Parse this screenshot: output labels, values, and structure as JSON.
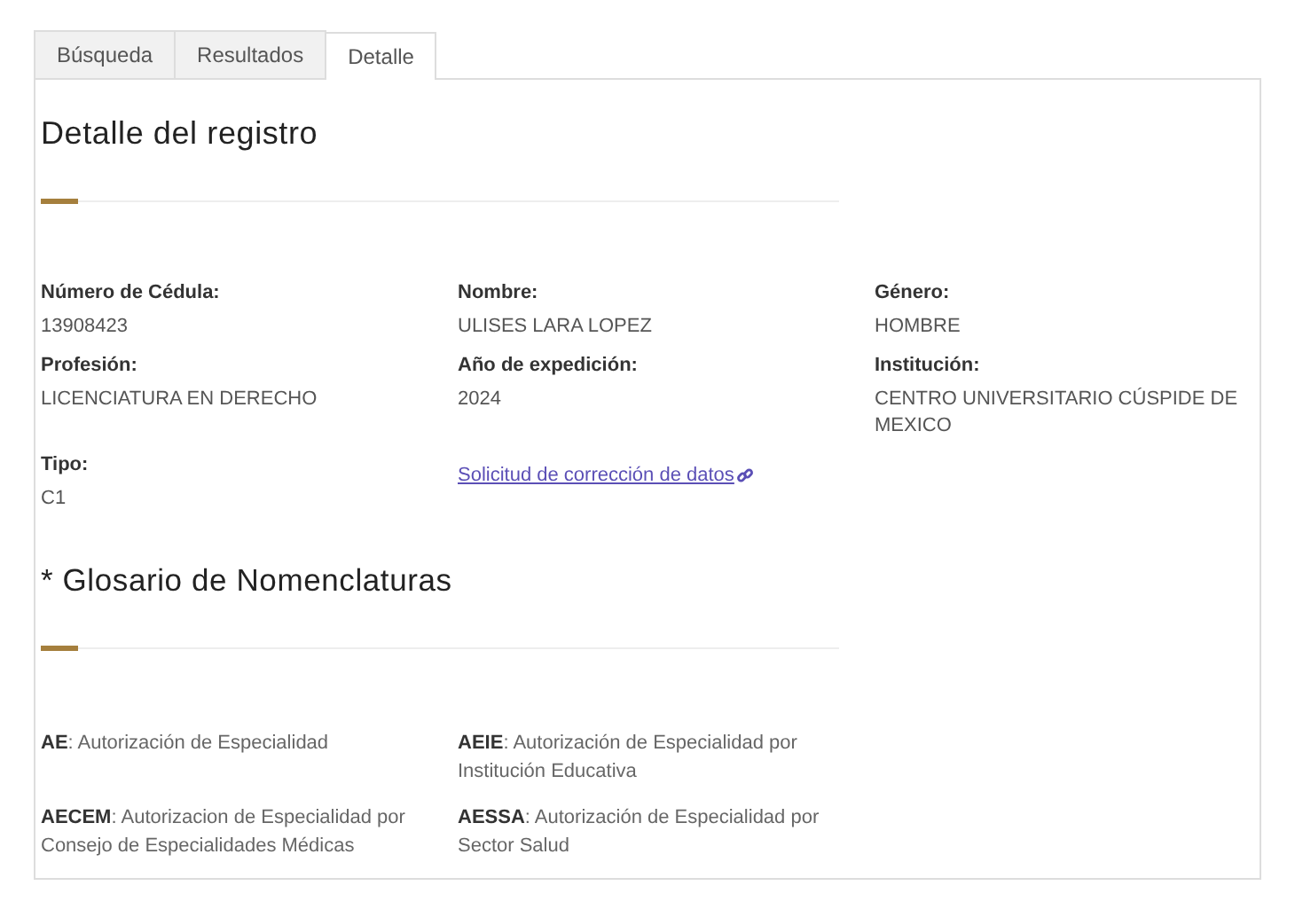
{
  "tabs": [
    {
      "label": "Búsqueda",
      "selected": false
    },
    {
      "label": "Resultados",
      "selected": false
    },
    {
      "label": "Detalle",
      "selected": true
    }
  ],
  "detail": {
    "title": "Detalle del registro",
    "fields": [
      {
        "label": "Número de Cédula:",
        "value": "13908423"
      },
      {
        "label": "Nombre:",
        "value": "ULISES LARA LOPEZ"
      },
      {
        "label": "Género:",
        "value": "HOMBRE"
      },
      {
        "label": "Profesión:",
        "value": "LICENCIATURA EN DERECHO"
      },
      {
        "label": "Año de expedición:",
        "value": "2024"
      },
      {
        "label": "Institución:",
        "value": "CENTRO UNIVERSITARIO CÚSPIDE DE MEXICO"
      },
      {
        "label": "Tipo:",
        "value": "C1"
      }
    ],
    "link": "Solicitud de corrección de datos"
  },
  "glossary": {
    "title": "* Glosario de Nomenclaturas",
    "entries": [
      "**AE**: Autorización de Especialidad",
      "**AEIE**: Autorización de Especialidad por Institución Educativa",
      "**AECEM**: Autorizacion de Especialidad por Consejo de Especialidades Médicas",
      "**AESSA**: Autorización de Especialidad por Sector Salud"
    ]
  }
}
